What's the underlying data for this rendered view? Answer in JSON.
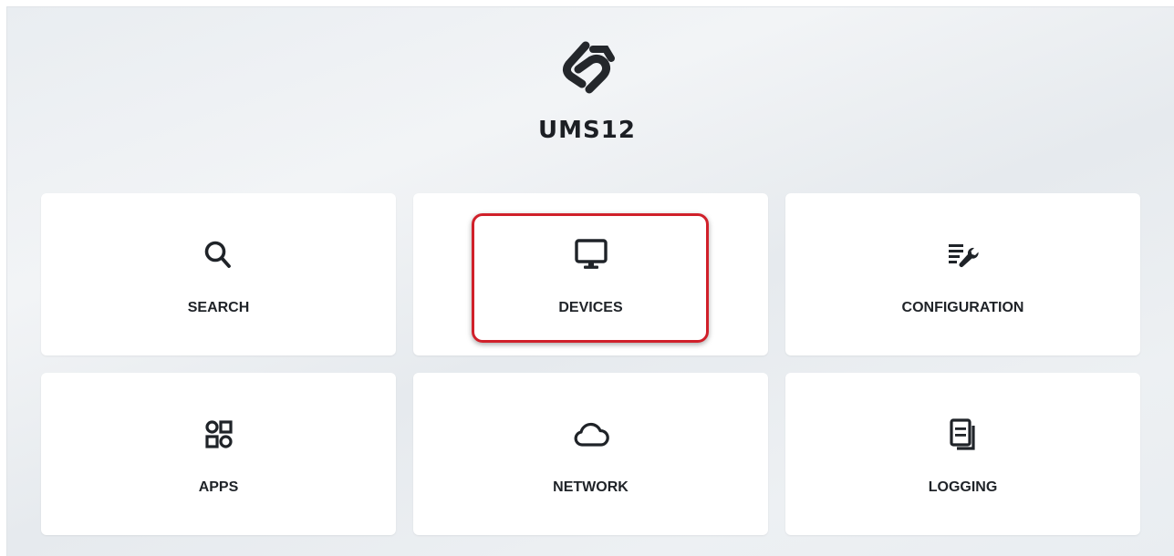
{
  "brand": {
    "name": "UMS12",
    "logo_icon": "ums-logo-icon"
  },
  "tiles": [
    {
      "label": "SEARCH",
      "icon": "search-icon"
    },
    {
      "label": "DEVICES",
      "icon": "monitor-icon"
    },
    {
      "label": "CONFIGURATION",
      "icon": "configuration-icon"
    },
    {
      "label": "APPS",
      "icon": "apps-icon"
    },
    {
      "label": "NETWORK",
      "icon": "cloud-icon"
    },
    {
      "label": "LOGGING",
      "icon": "logging-icon"
    }
  ],
  "highlighted_tile": "DEVICES",
  "colors": {
    "highlight_border": "#d0202a",
    "background": "#eceff2",
    "tile": "#ffffff",
    "text": "#1f2328"
  }
}
